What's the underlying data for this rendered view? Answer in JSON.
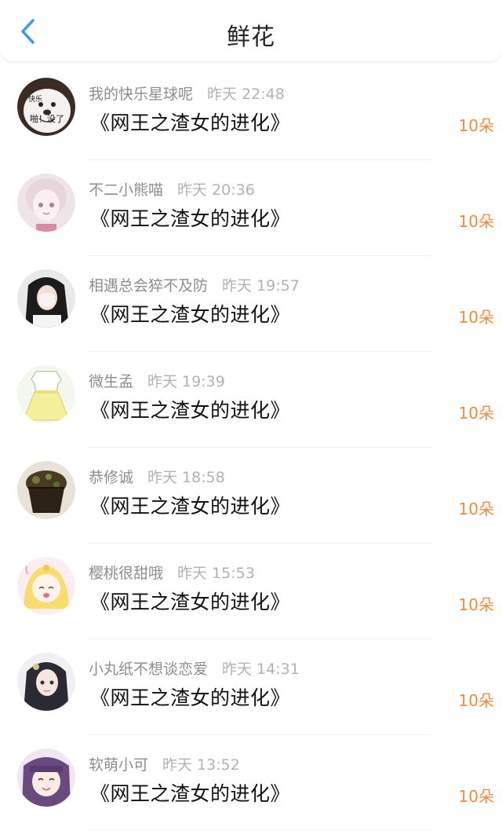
{
  "header": {
    "title": "鲜花",
    "back_icon": "chevron-left-icon",
    "accent": "#3a9bf0"
  },
  "colors": {
    "count": "#f08a3c",
    "username": "#8d8d8d",
    "time": "#b2b2b2"
  },
  "items": [
    {
      "user": "我的快乐星球呢",
      "time": "昨天 22:48",
      "book": "《网王之渣女的进化》",
      "count": "10朵"
    },
    {
      "user": "不二小熊喵",
      "time": "昨天 20:36",
      "book": "《网王之渣女的进化》",
      "count": "10朵"
    },
    {
      "user": "相遇总会猝不及防",
      "time": "昨天 19:57",
      "book": "《网王之渣女的进化》",
      "count": "10朵"
    },
    {
      "user": "微生孟",
      "time": "昨天 19:39",
      "book": "《网王之渣女的进化》",
      "count": "10朵"
    },
    {
      "user": "恭修诚",
      "time": "昨天 18:58",
      "book": "《网王之渣女的进化》",
      "count": "10朵"
    },
    {
      "user": "樱桃很甜哦",
      "time": "昨天 15:53",
      "book": "《网王之渣女的进化》",
      "count": "10朵"
    },
    {
      "user": "小丸纸不想谈恋爱",
      "time": "昨天 14:31",
      "book": "《网王之渣女的进化》",
      "count": "10朵"
    },
    {
      "user": "软萌小可",
      "time": "昨天 13:52",
      "book": "《网王之渣女的进化》",
      "count": "10朵"
    }
  ],
  "avatar_texts": {
    "first_top": "快乐",
    "first_bottom": "啪！没了"
  }
}
